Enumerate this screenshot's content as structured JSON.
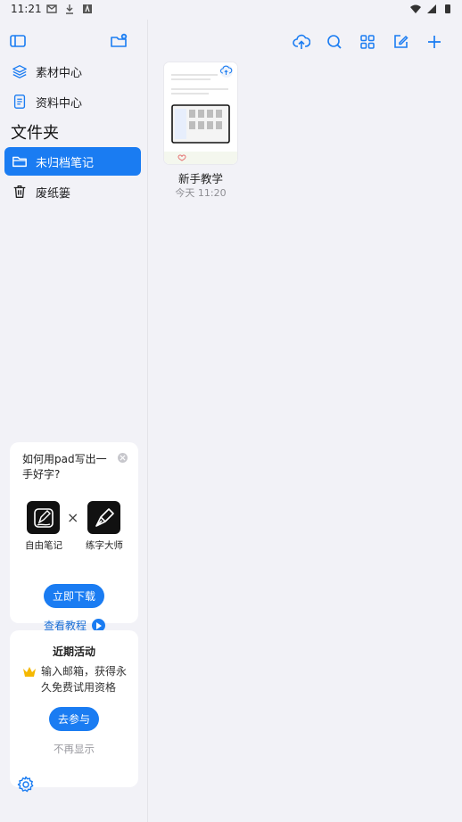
{
  "status_bar": {
    "time": "11:21",
    "left_icons": [
      "gmail-icon",
      "download-icon",
      "app-icon"
    ],
    "right_icons": [
      "wifi-icon",
      "signal-icon",
      "battery-icon"
    ]
  },
  "sidebar": {
    "items": [
      {
        "label": "素材中心",
        "icon": "layers-icon"
      },
      {
        "label": "资料中心",
        "icon": "document-icon"
      }
    ],
    "section_title": "文件夹",
    "folders": [
      {
        "label": "未归档笔记",
        "icon": "folder-icon",
        "active": true
      },
      {
        "label": "废纸篓",
        "icon": "trash-icon",
        "active": false
      }
    ]
  },
  "promo": {
    "question": "如何用pad写出一手好字?",
    "app1_name": "自由笔记",
    "app2_name": "练字大师",
    "times_symbol": "×",
    "download_label": "立即下载",
    "tutorial_label": "查看教程"
  },
  "activity": {
    "title": "近期活动",
    "text": "输入邮箱，获得永久免费试用资格",
    "join_label": "去参与",
    "hide_label": "不再显示"
  },
  "toolbar": {
    "icons": [
      "cloud-upload-icon",
      "search-icon",
      "grid-view-icon",
      "edit-icon",
      "add-icon"
    ]
  },
  "notes": [
    {
      "title": "新手教学",
      "date": "今天 11:20"
    }
  ],
  "colors": {
    "accent": "#1a7cf2",
    "background": "#f2f2f7",
    "card": "#ffffff"
  }
}
